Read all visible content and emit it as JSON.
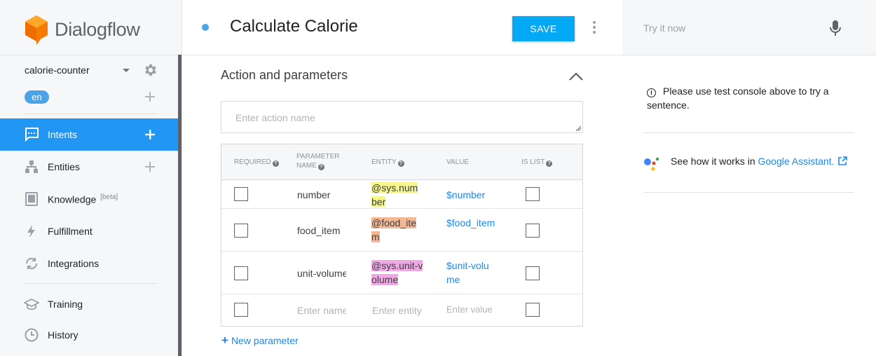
{
  "brand": {
    "name": "Dialogflow"
  },
  "agent": {
    "name": "calorie-counter",
    "language": "en"
  },
  "nav": {
    "intents": "Intents",
    "entities": "Entities",
    "knowledge": "Knowledge",
    "knowledge_badge": "[beta]",
    "fulfillment": "Fulfillment",
    "integrations": "Integrations",
    "training": "Training",
    "history": "History"
  },
  "intent": {
    "title": "Calculate Calorie",
    "save_label": "SAVE"
  },
  "action_section": {
    "title": "Action and parameters",
    "action_placeholder": "Enter action name"
  },
  "table": {
    "headers": {
      "required": "REQUIRED",
      "parameter_name_1": "PARAMETER",
      "parameter_name_2": "NAME",
      "entity": "ENTITY",
      "value": "VALUE",
      "is_list": "IS LIST"
    },
    "rows": [
      {
        "name": "number",
        "entity_l1": "@sys.num",
        "entity_l2": "ber",
        "value_l1": "$number",
        "value_l2": ""
      },
      {
        "name": "food_item",
        "entity_l1": "@food_ite",
        "entity_l2": "m",
        "value_l1": "$food_item",
        "value_l2": ""
      },
      {
        "name": "unit-volume",
        "entity_l1": "@sys.unit-v",
        "entity_l2": "olume",
        "value_l1": "$unit-volu",
        "value_l2": "me"
      }
    ],
    "empty_row": {
      "name_placeholder": "Enter name",
      "entity_placeholder": "Enter entity",
      "value_placeholder": "Enter value"
    },
    "new_param": "New parameter"
  },
  "console": {
    "try_placeholder": "Try it now",
    "info_text": "Please use test console above to try a sentence.",
    "ga_text": "See how it works in ",
    "ga_link": "Google Assistant."
  },
  "colors": {
    "accent": "#2196f3",
    "save": "#03a9f4",
    "entity_sys_number": "#f6f68a",
    "entity_food_item": "#f5b895",
    "entity_unit_volume": "#f0a9e4"
  }
}
